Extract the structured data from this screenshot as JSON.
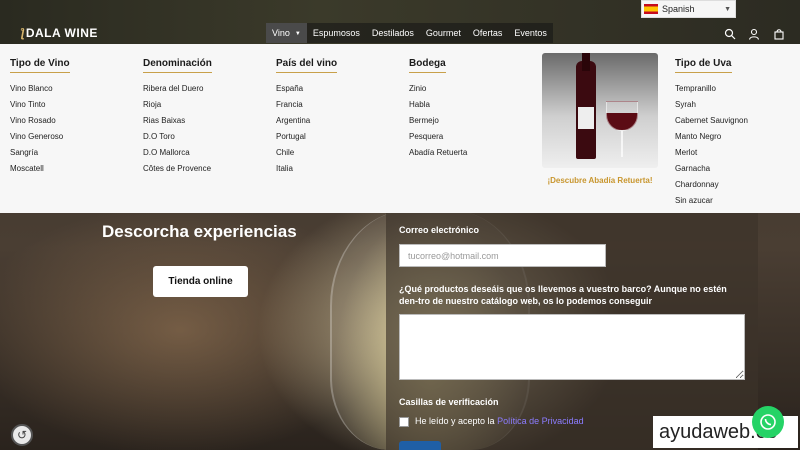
{
  "brand": {
    "name": "DALA WINE"
  },
  "nav": {
    "items": [
      {
        "label": "Vino",
        "active": true,
        "has_dropdown": true
      },
      {
        "label": "Espumosos",
        "active": false,
        "has_dropdown": true
      },
      {
        "label": "Destilados",
        "active": false,
        "has_dropdown": false
      },
      {
        "label": "Gourmet",
        "active": false,
        "has_dropdown": false
      },
      {
        "label": "Ofertas",
        "active": false,
        "has_dropdown": false
      },
      {
        "label": "Eventos",
        "active": false,
        "has_dropdown": false
      }
    ]
  },
  "language": {
    "selected": "Spanish"
  },
  "header_icons": [
    "search-icon",
    "user-icon",
    "cart-icon"
  ],
  "mega_menu": {
    "columns": [
      {
        "title": "Tipo de Vino",
        "items": [
          "Vino Blanco",
          "Vino Tinto",
          "Vino Rosado",
          "Vino Generoso",
          "Sangría",
          "Moscatell"
        ]
      },
      {
        "title": "Denominación",
        "items": [
          "Ribera del Duero",
          "Rioja",
          "Rias Baixas",
          "D.O Toro",
          "D.O Mallorca",
          "Côtes de Provence"
        ]
      },
      {
        "title": "País del vino",
        "items": [
          "España",
          "Francia",
          "Argentina",
          "Portugal",
          "Chile",
          "Italia"
        ]
      },
      {
        "title": "Bodega",
        "items": [
          "Zinio",
          "Habla",
          "Bermejo",
          "Pesquera",
          "Abadía Retuerta"
        ]
      },
      {
        "title": "Tipo de Uva",
        "items": [
          "Tempranillo",
          "Syrah",
          "Cabernet Sauvignon",
          "Manto Negro",
          "Merlot",
          "Garnacha",
          "Chardonnay",
          "Sin azucar"
        ]
      }
    ],
    "promo": {
      "link": "¡Descubre Abadía Retuerta!"
    }
  },
  "hero": {
    "title": "Descorcha experiencias",
    "button": "Tienda online"
  },
  "form": {
    "email_label": "Correo electrónico",
    "email_placeholder": "tucorreo@hotmail.com",
    "question_label": "¿Qué productos deseáis que os llevemos a vuestro barco? Aunque no estén den-tro de nuestro catálogo web, os lo podemos conseguir",
    "checkbox_group_label": "Casillas de verificación",
    "privacy_text": "He leído y acepto la ",
    "privacy_link": "Política de Privacidad"
  },
  "watermark": "ayudaweb.es",
  "colors": {
    "accent": "#c8962e",
    "whatsapp": "#25d366",
    "link": "#8c7cff"
  }
}
